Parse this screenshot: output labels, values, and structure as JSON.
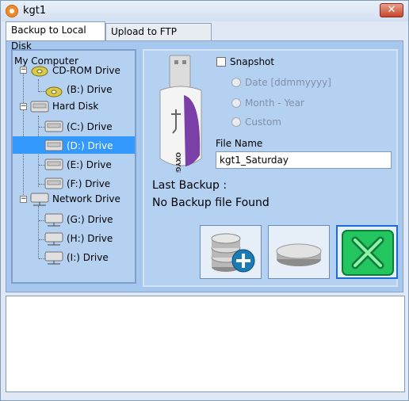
{
  "window": {
    "title": "kgt1",
    "close_label": "✕"
  },
  "tabs": [
    {
      "label": "Backup to Local Disk",
      "active": true
    },
    {
      "label": "Upload to FTP Server",
      "active": false
    }
  ],
  "tree": {
    "root": "My Computer",
    "groups": [
      {
        "label": "CD-ROM Drive",
        "icon": "cdrom-icon",
        "children": [
          {
            "label": "(B:) Drive"
          }
        ]
      },
      {
        "label": "Hard Disk",
        "icon": "hard-disk-icon",
        "children": [
          {
            "label": "(C:) Drive"
          },
          {
            "label": "(D:) Drive",
            "selected": true
          },
          {
            "label": "(E:) Drive"
          },
          {
            "label": "(F:) Drive"
          }
        ]
      },
      {
        "label": "Network Drive",
        "icon": "network-drive-icon",
        "children": [
          {
            "label": "(G:) Drive"
          },
          {
            "label": "(H:) Drive"
          },
          {
            "label": "(I:) Drive"
          }
        ]
      }
    ]
  },
  "options": {
    "snapshot_label": "Snapshot",
    "snapshot_checked": false,
    "radio_options": [
      {
        "label": "Date [ddmmyyyy]"
      },
      {
        "label": "Month - Year"
      },
      {
        "label": "Custom"
      }
    ]
  },
  "file_name": {
    "label": "File Name",
    "value": "kgt1_Saturday"
  },
  "usb_brand": "OXYGEN",
  "last_backup": {
    "label": "Last Backup :",
    "value": "No Backup file Found"
  },
  "buttons": [
    {
      "name": "backup-button",
      "icon": "database-add-icon"
    },
    {
      "name": "disk-button",
      "icon": "disk-icon"
    },
    {
      "name": "cancel-button",
      "icon": "close-x-icon"
    }
  ],
  "colors": {
    "panel": "#b5d1f2",
    "selected": "#3399ff",
    "cancel_green": "#22c55e"
  }
}
